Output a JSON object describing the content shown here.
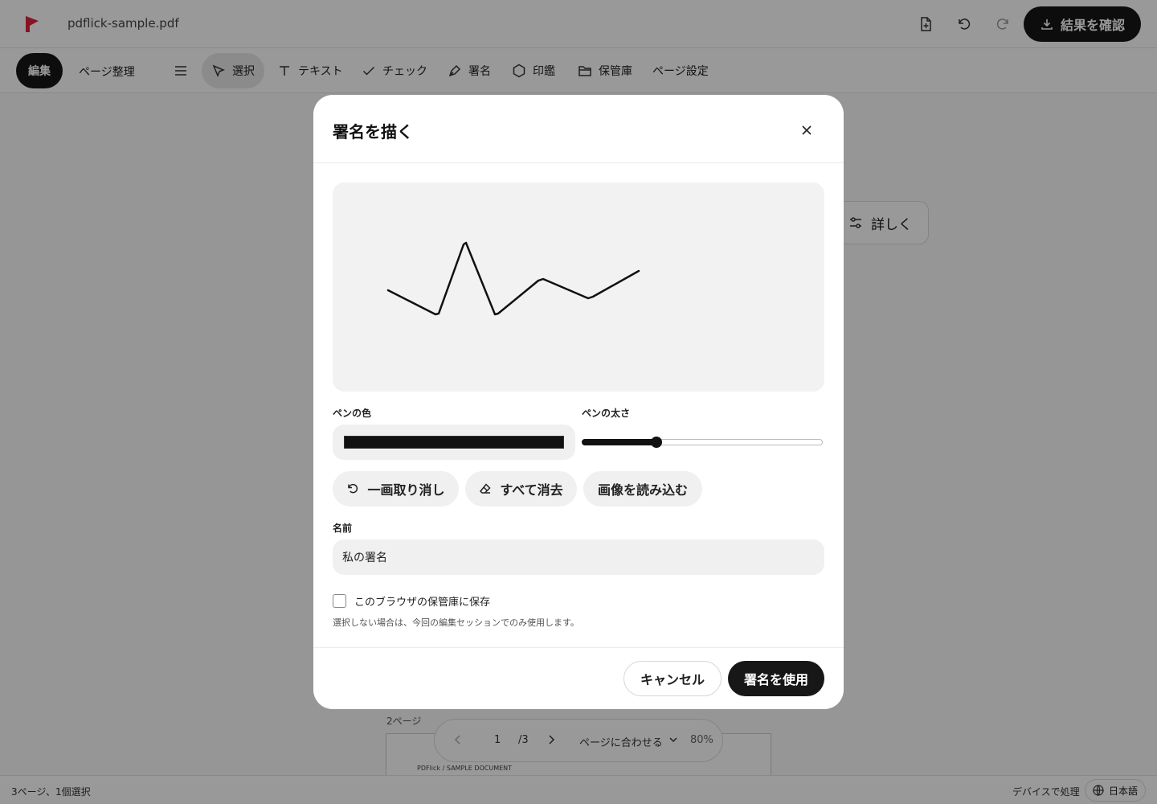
{
  "app": {
    "filename": "pdflick-sample.pdf",
    "result_button": "結果を確認",
    "brand_color": "#e0223a"
  },
  "toolbar": {
    "mode_edit": "編集",
    "mode_pages": "ページ整理",
    "tools": {
      "select": "選択",
      "text": "テキスト",
      "check": "チェック",
      "signature": "署名",
      "stamp": "印鑑",
      "vault": "保管庫",
      "page_settings": "ページ設定"
    },
    "active_tool": "select"
  },
  "main": {
    "details_button": "詳しく",
    "page_label": "2ページ",
    "page_thumb_text": "PDFlick / SAMPLE DOCUMENT"
  },
  "pager": {
    "current_page": "1",
    "total": "/3",
    "fit": "ページに合わせる",
    "zoom": "80%"
  },
  "status": {
    "left": "3ページ、1個選択",
    "device": "デバイスで処理",
    "language": "日本語"
  },
  "modal": {
    "title": "署名を描く",
    "pen_color_label": "ペンの色",
    "pen_color": "#111111",
    "pen_width_label": "ペンの太さ",
    "pen_width_fraction": 0.31,
    "undo_stroke": "一画取り消し",
    "clear_all": "すべて消去",
    "load_image": "画像を読み込む",
    "name_label": "名前",
    "name_value": "私の署名",
    "save_to_vault_label": "このブラウザの保管庫に保存",
    "save_to_vault_checked": false,
    "hint": "選択しない場合は、今回の編集セッションでのみ使用します。",
    "cancel": "キャンセル",
    "use_signature": "署名を使用"
  }
}
